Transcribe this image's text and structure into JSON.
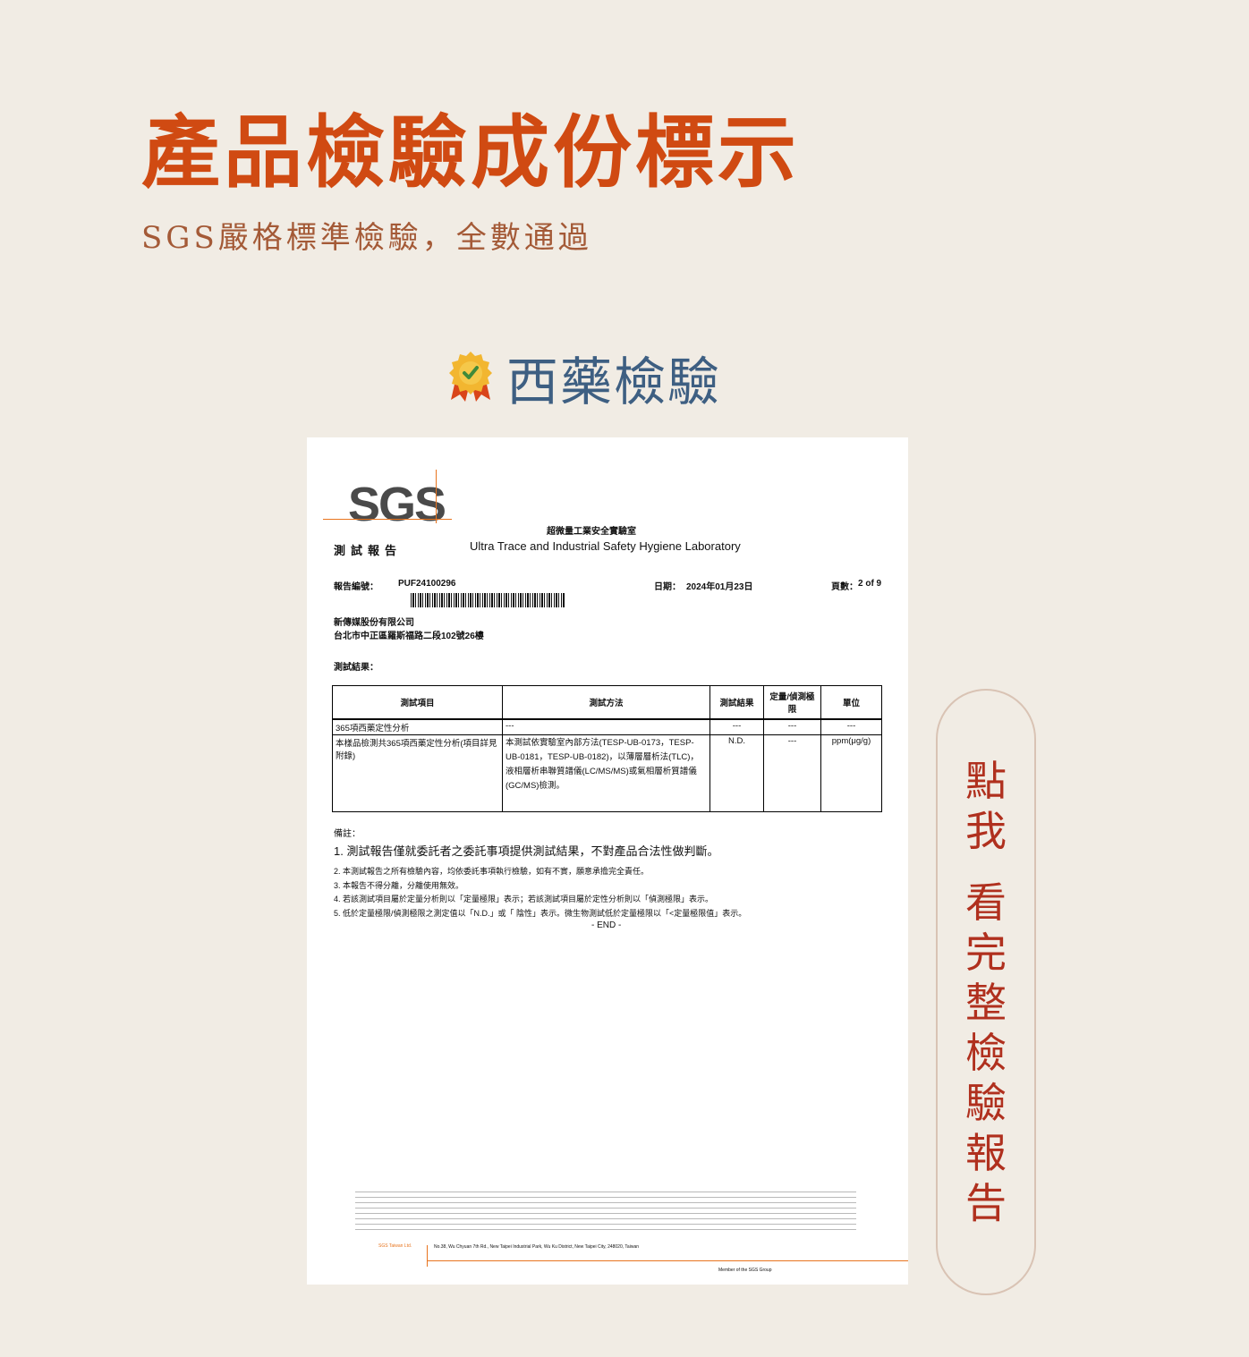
{
  "header": {
    "title": "產品檢驗成份標示",
    "subtitle": "SGS嚴格標準檢驗，全數通過"
  },
  "section": {
    "icon": "award-badge-icon",
    "title": "西藥檢驗"
  },
  "report": {
    "logo": "SGS",
    "lab_name_zh": "超微量工業安全實驗室",
    "lab_name_en": "Ultra Trace and Industrial Safety Hygiene Laboratory",
    "report_kind": "測試報告",
    "report_no_label": "報告編號：",
    "report_no": "PUF24100296",
    "date_label": "日期：",
    "date": "2024年01月23日",
    "page_label": "頁數：",
    "page": "2 of 9",
    "company": "新傳媒股份有限公司",
    "address": "台北市中正區羅斯福路二段102號26樓",
    "results_label": "測試結果：",
    "table": {
      "headers": [
        "測試項目",
        "測試方法",
        "測試結果",
        "定量/偵測極限",
        "單位"
      ],
      "rows": [
        [
          "365項西藥定性分析",
          "---",
          "---",
          "---",
          "---"
        ],
        [
          "本樣品檢測共365項西藥定性分析(項目詳見附錄)",
          "本測試依實驗室內部方法(TESP-UB-0173，TESP-UB-0181，TESP-UB-0182)，以薄層層析法(TLC)，液相層析串聯質譜儀(LC/MS/MS)或氣相層析質譜儀(GC/MS)檢測。",
          "N.D.",
          "---",
          "ppm(μg/g)"
        ]
      ]
    },
    "notes_label": "備註：",
    "notes": [
      "1. 測試報告僅就委託者之委託事項提供測試結果，不對產品合法性做判斷。",
      "2. 本測試報告之所有檢驗內容，均依委託事項執行檢驗，如有不實，願意承擔完全責任。",
      "3. 本報告不得分離，分離使用無效。",
      "4. 若該測試項目屬於定量分析則以「定量極限」表示；若該測試項目屬於定性分析則以「偵測極限」表示。",
      "5. 低於定量極限/偵測極限之測定值以「N.D.」或「 陰性」表示。微生物測試低於定量極限以「<定量極限值」表示。"
    ],
    "end": "- END -",
    "footer_sgs": "SGS Taiwan Ltd.",
    "footer_address": "No.38, Wu Chyuan 7th Rd., New Taipei Industrial Park, Wu Ku District, New Taipei City, 248020, Taiwan",
    "footer_member": "Member of the SGS Group"
  },
  "cta": {
    "line1": [
      "點",
      "我"
    ],
    "line2": [
      "看",
      "完",
      "整",
      "檢",
      "驗",
      "報",
      "告"
    ]
  },
  "colors": {
    "background": "#f1ece4",
    "title": "#d04a12",
    "subtitle": "#a45a37",
    "section_title": "#3e5f82",
    "cta_text": "#b0301e",
    "cta_border": "#d9c3b4",
    "sgs_accent": "#e8741e"
  }
}
